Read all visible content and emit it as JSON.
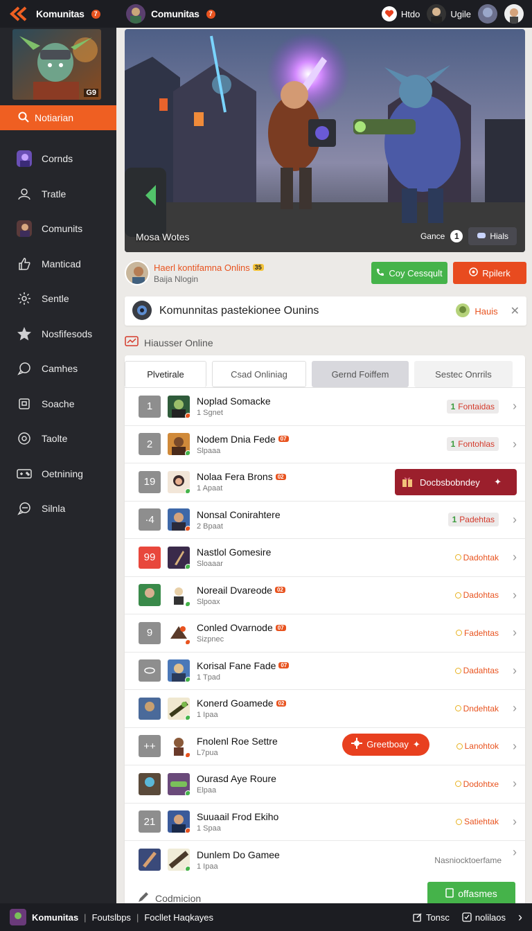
{
  "topbar": {
    "brand": "Komunitas",
    "brand_badge": "7",
    "center_title": "Comunitas",
    "center_badge": "7",
    "user1": "Htdo",
    "user2": "Ugile"
  },
  "sidebar": {
    "banner_tag": "G9",
    "search_label": "Notiarian",
    "items": [
      {
        "label": "Cornds",
        "icon": "game-avatar-icon"
      },
      {
        "label": "Tratle",
        "icon": "user-icon"
      },
      {
        "label": "Comunits",
        "icon": "community-avatar-icon"
      },
      {
        "label": "Manticad",
        "icon": "thumb-up-icon"
      },
      {
        "label": "Sentle",
        "icon": "gear-icon"
      },
      {
        "label": "Nosfifesods",
        "icon": "star-icon"
      },
      {
        "label": "Camhes",
        "icon": "chat-icon"
      },
      {
        "label": "Soache",
        "icon": "square-icon"
      },
      {
        "label": "Taolte",
        "icon": "target-icon"
      },
      {
        "label": "Oetnining",
        "icon": "controller-icon"
      },
      {
        "label": "Silnla",
        "icon": "chat-bubble-icon"
      }
    ]
  },
  "hero": {
    "caption": "Mosa Wotes",
    "game_label": "Gance",
    "count": "1",
    "pill_label": "Hials"
  },
  "user": {
    "name": "Haerl kontifamna Onlins",
    "level": "35",
    "sub": "Baija Nlogin",
    "btn_green": "Coy Cessqult",
    "btn_red": "Rpilerk"
  },
  "search": {
    "text": "Komunnitas pastekionee Ounins",
    "right_label": "Hauis"
  },
  "online_label": "Hiausser Online",
  "tabs": [
    "Plvetirale",
    "Csad Onliniag",
    "Gernd Foiffem",
    "Sestec Onrrils"
  ],
  "rows": [
    {
      "rank": "1",
      "title": "Noplad Somacke",
      "sub": "1 Sgnet",
      "status": "Fontaidas",
      "status_num": "1"
    },
    {
      "rank": "2",
      "title": "Nodem Dnia Fede",
      "tag": "07",
      "sub": "Slpaaa",
      "status": "Fontohlas",
      "status_num": "1"
    },
    {
      "rank": "19",
      "title": "Nolaa Fera Brons",
      "tag": "02",
      "sub": "1 Apaat",
      "overlay": "Docbsbobndey"
    },
    {
      "rank": "·4",
      "title": "Nonsal Conirahtere",
      "sub": "2 Bpaat",
      "status": "Padehtas",
      "status_num": "1"
    },
    {
      "rank": "99",
      "title": "Nastlol Gomesire",
      "sub": "Sloaaar",
      "status": "Dadohtak"
    },
    {
      "rank": "",
      "title": "Noreail Dvareode",
      "tag": "02",
      "sub": "Slpoax",
      "status": "Dadohtas"
    },
    {
      "rank": "9",
      "title": "Conled Ovarnode",
      "tag": "07",
      "sub": "Sizpnec",
      "status": "Fadehtas"
    },
    {
      "rank": "◯",
      "title": "Korisal Fane Fade",
      "tag": "07",
      "sub": "1 Tpad",
      "status": "Dadahtas"
    },
    {
      "rank": "",
      "title": "Konerd Goamede",
      "tag": "02",
      "sub": "1 Ipaa",
      "status": "Dndehtak"
    },
    {
      "rank": "++",
      "title": "Fnolenl Roe Settre",
      "sub": "L7pua",
      "status": "Lanohtok",
      "overlay": "Greetboay"
    },
    {
      "rank": "",
      "title": "Ourasd Aye Roure",
      "sub": "Elpaa",
      "status": "Dodohtxe"
    },
    {
      "rank": "21",
      "title": "Suuaail Frod Ekiho",
      "sub": "1 Spaa",
      "status": "Satiehtak"
    },
    {
      "rank": "",
      "title": "Dunlem Do Gamee",
      "sub": "1 Ipaa"
    }
  ],
  "card_footer": {
    "left": "Codmicion",
    "hint": "Nasniocktoerfame",
    "btn": "offasmes"
  },
  "bottombar": {
    "brand": "Komunitas",
    "link1": "Foutslbps",
    "link2": "Focllet Haqkayes",
    "right1": "Tonsc",
    "right2": "nolilaos"
  }
}
